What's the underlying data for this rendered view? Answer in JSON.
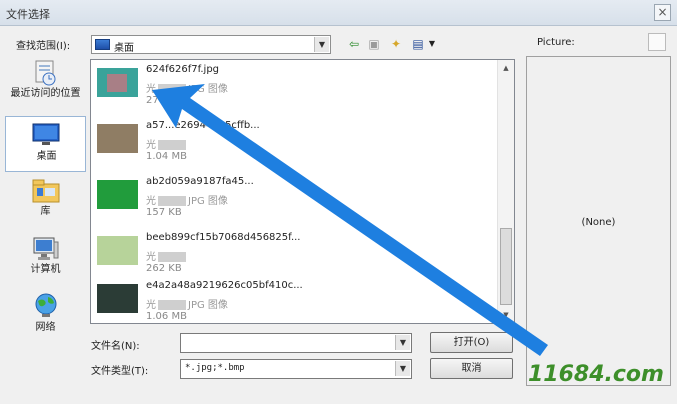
{
  "window": {
    "title": "文件选择",
    "close": "×"
  },
  "lookin": {
    "label": "查找范围(I):",
    "value": "桌面"
  },
  "places": [
    {
      "label": "最近访问的位置",
      "icon": "recent-places-icon"
    },
    {
      "label": "桌面",
      "icon": "desktop-icon"
    },
    {
      "label": "库",
      "icon": "library-icon"
    },
    {
      "label": "计算机",
      "icon": "computer-icon"
    },
    {
      "label": "网络",
      "icon": "network-icon"
    }
  ],
  "files": [
    {
      "name": "624f626f7f.jpg",
      "type_prefix": "光",
      "type_suffix": "JPG 图像",
      "size": "27",
      "thumb_color": "#3aa39a"
    },
    {
      "name": "a57...e26944d35cffb...",
      "type_prefix": "光",
      "type_suffix": "",
      "size": "1.04 MB",
      "thumb_color": "#8f7d64"
    },
    {
      "name": "ab2d059a9187fa45...",
      "type_prefix": "光",
      "type_suffix": "JPG 图像",
      "size": "157 KB",
      "thumb_color": "#219c3c"
    },
    {
      "name": "beeb899cf15b7068d456825f...",
      "type_prefix": "光",
      "type_suffix": "",
      "size": "262 KB",
      "thumb_color": "#b7d39a"
    },
    {
      "name": "e4a2a48a9219626c05bf410c...",
      "type_prefix": "光",
      "type_suffix": "JPG 图像",
      "size": "1.06 MB",
      "thumb_color": "#2b3c36"
    }
  ],
  "filename": {
    "label": "文件名(N):",
    "value": ""
  },
  "filetype": {
    "label": "文件类型(T):",
    "value": "*.jpg;*.bmp"
  },
  "buttons": {
    "open": "打开(O)",
    "cancel": "取消"
  },
  "preview": {
    "label": "Picture:",
    "none": "(None)"
  },
  "watermark": "11684.com",
  "colors": {
    "arrow": "#1e7fe0",
    "watermark": "#3d8f2a"
  }
}
